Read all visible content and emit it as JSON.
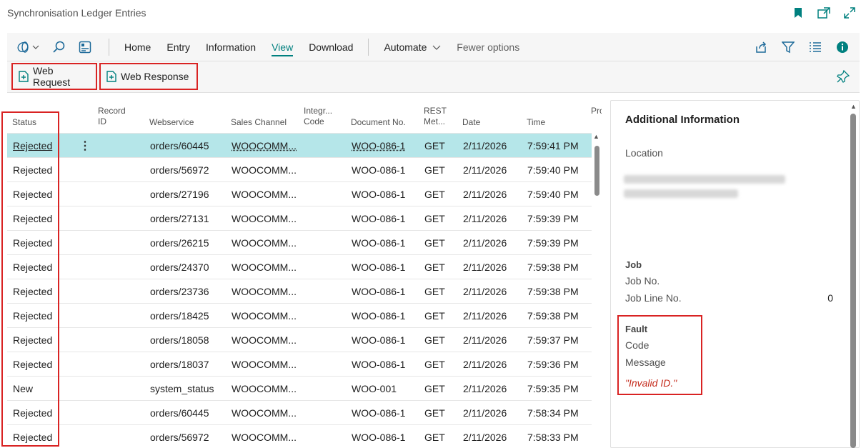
{
  "window": {
    "title": "Synchronisation Ledger Entries"
  },
  "title_icons": [
    "bookmark-icon",
    "open-new-window-icon",
    "expand-icon"
  ],
  "commands": {
    "left_icons": [
      "copilot-dropdown-icon",
      "search-icon",
      "edit-list-icon"
    ],
    "menu": [
      {
        "label": "Home"
      },
      {
        "label": "Entry"
      },
      {
        "label": "Information"
      },
      {
        "label": "View",
        "active": true
      },
      {
        "label": "Download"
      }
    ],
    "automate": "Automate",
    "fewer_options": "Fewer options",
    "right_icons": [
      "share-icon",
      "filter-icon",
      "list-view-icon",
      "info-icon"
    ]
  },
  "actions": {
    "web_request": "Web Request",
    "web_response": "Web Response"
  },
  "list": {
    "columns": {
      "status": "Status",
      "record_id_1": "Record",
      "record_id_2": "ID",
      "webservice": "Webservice",
      "sales_channel": "Sales Channel",
      "integr_1": "Integr...",
      "integr_2": "Code",
      "document_no": "Document No.",
      "rest_1": "REST",
      "rest_2": "Met...",
      "date": "Date",
      "time": "Time",
      "pro": "Pro"
    },
    "rows": [
      {
        "status": "Rejected",
        "webservice": "orders/60445",
        "channel": "WOOCOMM...",
        "document": "WOO-086-1",
        "method": "GET",
        "date": "2/11/2026",
        "time": "7:59:41 PM",
        "selected": true
      },
      {
        "status": "Rejected",
        "webservice": "orders/56972",
        "channel": "WOOCOMM...",
        "document": "WOO-086-1",
        "method": "GET",
        "date": "2/11/2026",
        "time": "7:59:40 PM"
      },
      {
        "status": "Rejected",
        "webservice": "orders/27196",
        "channel": "WOOCOMM...",
        "document": "WOO-086-1",
        "method": "GET",
        "date": "2/11/2026",
        "time": "7:59:40 PM"
      },
      {
        "status": "Rejected",
        "webservice": "orders/27131",
        "channel": "WOOCOMM...",
        "document": "WOO-086-1",
        "method": "GET",
        "date": "2/11/2026",
        "time": "7:59:39 PM"
      },
      {
        "status": "Rejected",
        "webservice": "orders/26215",
        "channel": "WOOCOMM...",
        "document": "WOO-086-1",
        "method": "GET",
        "date": "2/11/2026",
        "time": "7:59:39 PM"
      },
      {
        "status": "Rejected",
        "webservice": "orders/24370",
        "channel": "WOOCOMM...",
        "document": "WOO-086-1",
        "method": "GET",
        "date": "2/11/2026",
        "time": "7:59:38 PM"
      },
      {
        "status": "Rejected",
        "webservice": "orders/23736",
        "channel": "WOOCOMM...",
        "document": "WOO-086-1",
        "method": "GET",
        "date": "2/11/2026",
        "time": "7:59:38 PM"
      },
      {
        "status": "Rejected",
        "webservice": "orders/18425",
        "channel": "WOOCOMM...",
        "document": "WOO-086-1",
        "method": "GET",
        "date": "2/11/2026",
        "time": "7:59:38 PM"
      },
      {
        "status": "Rejected",
        "webservice": "orders/18058",
        "channel": "WOOCOMM...",
        "document": "WOO-086-1",
        "method": "GET",
        "date": "2/11/2026",
        "time": "7:59:37 PM"
      },
      {
        "status": "Rejected",
        "webservice": "orders/18037",
        "channel": "WOOCOMM...",
        "document": "WOO-086-1",
        "method": "GET",
        "date": "2/11/2026",
        "time": "7:59:36 PM"
      },
      {
        "status": "New",
        "webservice": "system_status",
        "channel": "WOOCOMM...",
        "document": "WOO-001",
        "method": "GET",
        "date": "2/11/2026",
        "time": "7:59:35 PM"
      },
      {
        "status": "Rejected",
        "webservice": "orders/60445",
        "channel": "WOOCOMM...",
        "document": "WOO-086-1",
        "method": "GET",
        "date": "2/11/2026",
        "time": "7:58:34 PM"
      },
      {
        "status": "Rejected",
        "webservice": "orders/56972",
        "channel": "WOOCOMM...",
        "document": "WOO-086-1",
        "method": "GET",
        "date": "2/11/2026",
        "time": "7:58:33 PM"
      }
    ]
  },
  "factbox": {
    "title": "Additional Information",
    "location_label": "Location",
    "job_group": "Job",
    "job_no_label": "Job No.",
    "job_line_label": "Job Line No.",
    "job_line_value": "0",
    "fault_group": "Fault",
    "code_label": "Code",
    "message_label": "Message",
    "message_value": "\"Invalid ID.\""
  },
  "colors": {
    "accent": "#00807f",
    "highlight_box": "#d92323",
    "selected_row": "#b5e6e9",
    "error_text": "#c42b1c"
  }
}
